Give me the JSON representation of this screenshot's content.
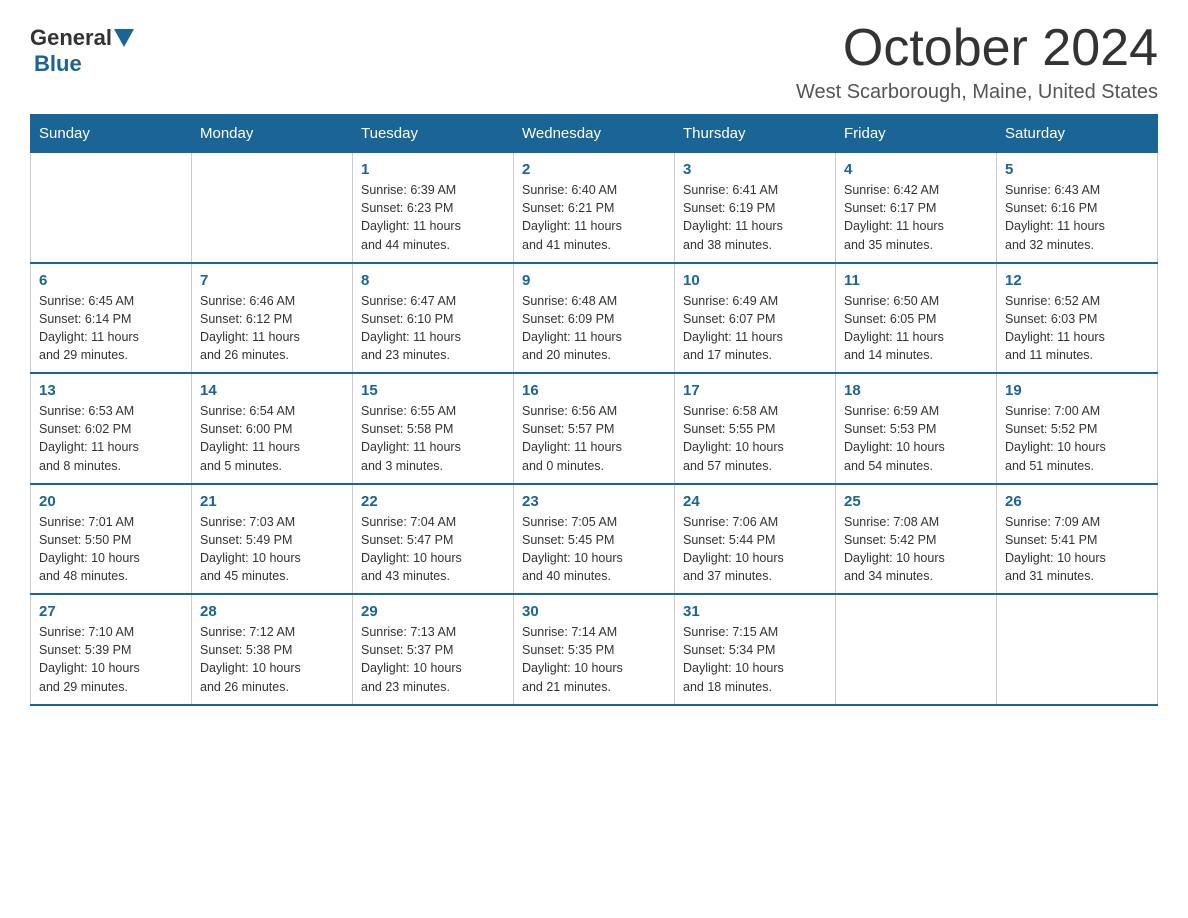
{
  "header": {
    "logo_general": "General",
    "logo_blue": "Blue",
    "month": "October 2024",
    "location": "West Scarborough, Maine, United States"
  },
  "days_of_week": [
    "Sunday",
    "Monday",
    "Tuesday",
    "Wednesday",
    "Thursday",
    "Friday",
    "Saturday"
  ],
  "weeks": [
    [
      {
        "day": "",
        "info": ""
      },
      {
        "day": "",
        "info": ""
      },
      {
        "day": "1",
        "info": "Sunrise: 6:39 AM\nSunset: 6:23 PM\nDaylight: 11 hours\nand 44 minutes."
      },
      {
        "day": "2",
        "info": "Sunrise: 6:40 AM\nSunset: 6:21 PM\nDaylight: 11 hours\nand 41 minutes."
      },
      {
        "day": "3",
        "info": "Sunrise: 6:41 AM\nSunset: 6:19 PM\nDaylight: 11 hours\nand 38 minutes."
      },
      {
        "day": "4",
        "info": "Sunrise: 6:42 AM\nSunset: 6:17 PM\nDaylight: 11 hours\nand 35 minutes."
      },
      {
        "day": "5",
        "info": "Sunrise: 6:43 AM\nSunset: 6:16 PM\nDaylight: 11 hours\nand 32 minutes."
      }
    ],
    [
      {
        "day": "6",
        "info": "Sunrise: 6:45 AM\nSunset: 6:14 PM\nDaylight: 11 hours\nand 29 minutes."
      },
      {
        "day": "7",
        "info": "Sunrise: 6:46 AM\nSunset: 6:12 PM\nDaylight: 11 hours\nand 26 minutes."
      },
      {
        "day": "8",
        "info": "Sunrise: 6:47 AM\nSunset: 6:10 PM\nDaylight: 11 hours\nand 23 minutes."
      },
      {
        "day": "9",
        "info": "Sunrise: 6:48 AM\nSunset: 6:09 PM\nDaylight: 11 hours\nand 20 minutes."
      },
      {
        "day": "10",
        "info": "Sunrise: 6:49 AM\nSunset: 6:07 PM\nDaylight: 11 hours\nand 17 minutes."
      },
      {
        "day": "11",
        "info": "Sunrise: 6:50 AM\nSunset: 6:05 PM\nDaylight: 11 hours\nand 14 minutes."
      },
      {
        "day": "12",
        "info": "Sunrise: 6:52 AM\nSunset: 6:03 PM\nDaylight: 11 hours\nand 11 minutes."
      }
    ],
    [
      {
        "day": "13",
        "info": "Sunrise: 6:53 AM\nSunset: 6:02 PM\nDaylight: 11 hours\nand 8 minutes."
      },
      {
        "day": "14",
        "info": "Sunrise: 6:54 AM\nSunset: 6:00 PM\nDaylight: 11 hours\nand 5 minutes."
      },
      {
        "day": "15",
        "info": "Sunrise: 6:55 AM\nSunset: 5:58 PM\nDaylight: 11 hours\nand 3 minutes."
      },
      {
        "day": "16",
        "info": "Sunrise: 6:56 AM\nSunset: 5:57 PM\nDaylight: 11 hours\nand 0 minutes."
      },
      {
        "day": "17",
        "info": "Sunrise: 6:58 AM\nSunset: 5:55 PM\nDaylight: 10 hours\nand 57 minutes."
      },
      {
        "day": "18",
        "info": "Sunrise: 6:59 AM\nSunset: 5:53 PM\nDaylight: 10 hours\nand 54 minutes."
      },
      {
        "day": "19",
        "info": "Sunrise: 7:00 AM\nSunset: 5:52 PM\nDaylight: 10 hours\nand 51 minutes."
      }
    ],
    [
      {
        "day": "20",
        "info": "Sunrise: 7:01 AM\nSunset: 5:50 PM\nDaylight: 10 hours\nand 48 minutes."
      },
      {
        "day": "21",
        "info": "Sunrise: 7:03 AM\nSunset: 5:49 PM\nDaylight: 10 hours\nand 45 minutes."
      },
      {
        "day": "22",
        "info": "Sunrise: 7:04 AM\nSunset: 5:47 PM\nDaylight: 10 hours\nand 43 minutes."
      },
      {
        "day": "23",
        "info": "Sunrise: 7:05 AM\nSunset: 5:45 PM\nDaylight: 10 hours\nand 40 minutes."
      },
      {
        "day": "24",
        "info": "Sunrise: 7:06 AM\nSunset: 5:44 PM\nDaylight: 10 hours\nand 37 minutes."
      },
      {
        "day": "25",
        "info": "Sunrise: 7:08 AM\nSunset: 5:42 PM\nDaylight: 10 hours\nand 34 minutes."
      },
      {
        "day": "26",
        "info": "Sunrise: 7:09 AM\nSunset: 5:41 PM\nDaylight: 10 hours\nand 31 minutes."
      }
    ],
    [
      {
        "day": "27",
        "info": "Sunrise: 7:10 AM\nSunset: 5:39 PM\nDaylight: 10 hours\nand 29 minutes."
      },
      {
        "day": "28",
        "info": "Sunrise: 7:12 AM\nSunset: 5:38 PM\nDaylight: 10 hours\nand 26 minutes."
      },
      {
        "day": "29",
        "info": "Sunrise: 7:13 AM\nSunset: 5:37 PM\nDaylight: 10 hours\nand 23 minutes."
      },
      {
        "day": "30",
        "info": "Sunrise: 7:14 AM\nSunset: 5:35 PM\nDaylight: 10 hours\nand 21 minutes."
      },
      {
        "day": "31",
        "info": "Sunrise: 7:15 AM\nSunset: 5:34 PM\nDaylight: 10 hours\nand 18 minutes."
      },
      {
        "day": "",
        "info": ""
      },
      {
        "day": "",
        "info": ""
      }
    ]
  ]
}
